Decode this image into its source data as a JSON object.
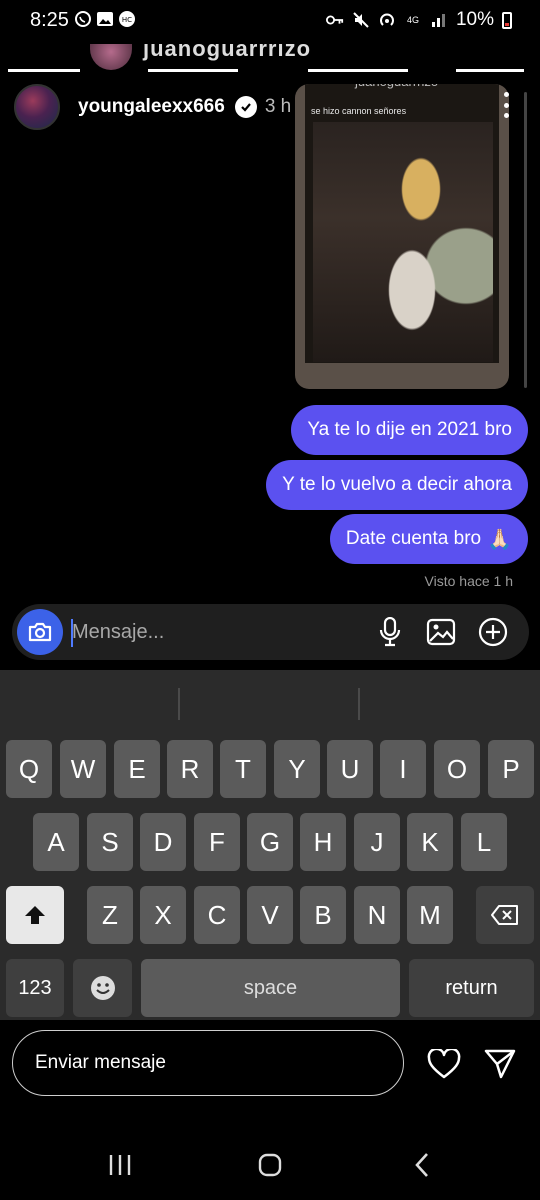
{
  "status_bar": {
    "time": "8:25",
    "battery": "10%",
    "network": "4G",
    "left_icons": [
      "whatsapp-icon",
      "image-icon",
      "hc-icon"
    ],
    "right_icons": [
      "key-icon",
      "mute-icon",
      "hotspot-icon",
      "signal-icon"
    ]
  },
  "top_strip": {
    "partial_name": "juanoguarrrizo"
  },
  "shared_story": {
    "username": "youngaleexx666",
    "time_ago": "3 h",
    "verified": true,
    "caption": "se hizo cannon señores",
    "story_account": "juanoguarrrizo"
  },
  "messages": [
    {
      "text": "Ya te lo dije en 2021 bro",
      "emoji": ""
    },
    {
      "text": "Y te lo vuelvo a decir ahora",
      "emoji": ""
    },
    {
      "text": "Date cuenta bro",
      "emoji": "🙏🏻"
    }
  ],
  "seen_label": "Visto hace 1 h",
  "composer": {
    "placeholder": "Mensaje..."
  },
  "keyboard": {
    "row1": [
      "Q",
      "W",
      "E",
      "R",
      "T",
      "Y",
      "U",
      "I",
      "O",
      "P"
    ],
    "row2": [
      "A",
      "S",
      "D",
      "F",
      "G",
      "H",
      "J",
      "K",
      "L"
    ],
    "row3": [
      "Z",
      "X",
      "C",
      "V",
      "B",
      "N",
      "M"
    ],
    "numbers_label": "123",
    "space_label": "space",
    "return_label": "return"
  },
  "reply_bar": {
    "placeholder": "Enviar mensaje"
  },
  "colors": {
    "bubble": "#5b51f0",
    "camera_button": "#3c62e8",
    "keyboard_bg": "#2b2b2b",
    "key": "#5b5b5b"
  }
}
